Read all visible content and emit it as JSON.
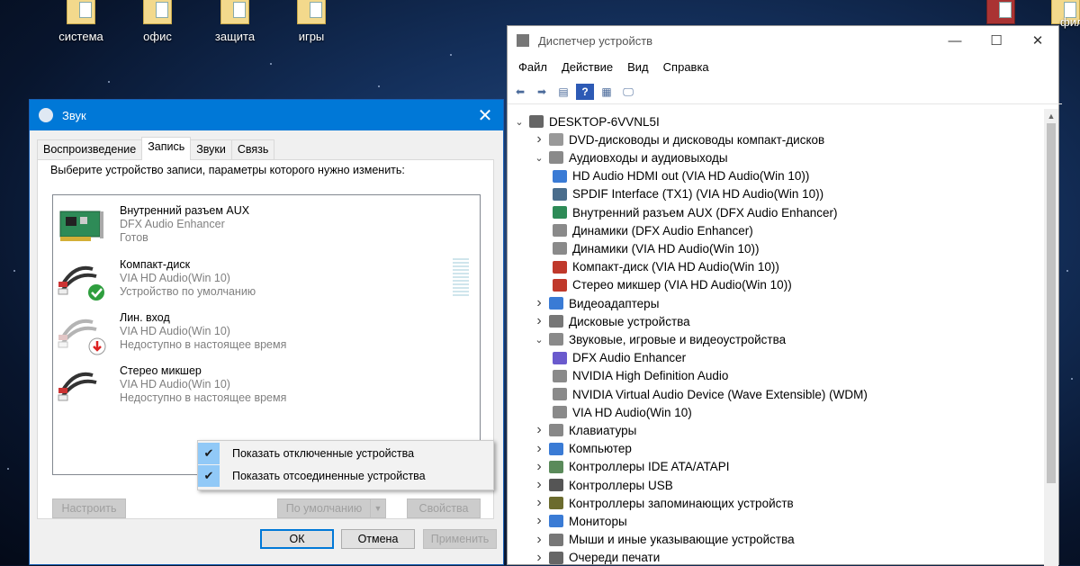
{
  "desktop": {
    "icons": [
      "система",
      "офис",
      "защита",
      "игры"
    ],
    "right_label": "фили"
  },
  "sound": {
    "title": "Звук",
    "tabs": [
      "Воспроизведение",
      "Запись",
      "Звуки",
      "Связь"
    ],
    "instruction": "Выберите устройство записи, параметры которого нужно изменить:",
    "devices": [
      {
        "name": "Внутренний разъем  AUX",
        "driver": "DFX Audio Enhancer",
        "status": "Готов"
      },
      {
        "name": "Компакт-диск",
        "driver": "VIA HD Audio(Win 10)",
        "status": "Устройство по умолчанию"
      },
      {
        "name": "Лин. вход",
        "driver": "VIA HD Audio(Win 10)",
        "status": "Недоступно в настоящее время"
      },
      {
        "name": "Стерео микшер",
        "driver": "VIA HD Audio(Win 10)",
        "status": "Недоступно в настоящее время"
      }
    ],
    "buttons": {
      "configure": "Настроить",
      "set_default": "По умолчанию",
      "properties": "Свойства",
      "ok": "ОК",
      "cancel": "Отмена",
      "apply": "Применить"
    },
    "context_menu": [
      "Показать отключенные устройства",
      "Показать отсоединенные устройства"
    ]
  },
  "devmgr": {
    "title": "Диспетчер устройств",
    "menu": [
      "Файл",
      "Действие",
      "Вид",
      "Справка"
    ],
    "tree": [
      {
        "label": "DESKTOP-6VVNL5I",
        "level": 0,
        "exp": "open",
        "icon": "computer-icon"
      },
      {
        "label": "DVD-дисководы и дисководы компакт-дисков",
        "level": 1,
        "exp": "closed",
        "icon": "dvd-drive-icon"
      },
      {
        "label": "Аудиовходы и аудиовыходы",
        "level": 1,
        "exp": "open",
        "icon": "speaker-icon"
      },
      {
        "label": "HD Audio HDMI out (VIA HD Audio(Win 10))",
        "level": 2,
        "exp": "",
        "icon": "monitor-icon"
      },
      {
        "label": "SPDIF Interface (TX1) (VIA HD Audio(Win 10))",
        "level": 2,
        "exp": "",
        "icon": "spdif-icon"
      },
      {
        "label": "Внутренний разъем  AUX (DFX Audio Enhancer)",
        "level": 2,
        "exp": "",
        "icon": "sound-card-icon"
      },
      {
        "label": "Динамики (DFX Audio Enhancer)",
        "level": 2,
        "exp": "",
        "icon": "speaker-icon"
      },
      {
        "label": "Динамики (VIA HD Audio(Win 10))",
        "level": 2,
        "exp": "",
        "icon": "speaker-icon"
      },
      {
        "label": "Компакт-диск (VIA HD Audio(Win 10))",
        "level": 2,
        "exp": "",
        "icon": "rca-cable-icon"
      },
      {
        "label": "Стерео микшер (VIA HD Audio(Win 10))",
        "level": 2,
        "exp": "",
        "icon": "rca-cable-icon"
      },
      {
        "label": "Видеоадаптеры",
        "level": 1,
        "exp": "closed",
        "icon": "display-adapter-icon"
      },
      {
        "label": "Дисковые устройства",
        "level": 1,
        "exp": "closed",
        "icon": "disk-drive-icon"
      },
      {
        "label": "Звуковые, игровые и видеоустройства",
        "level": 1,
        "exp": "open",
        "icon": "speaker-icon"
      },
      {
        "label": "DFX Audio Enhancer",
        "level": 2,
        "exp": "",
        "icon": "equalizer-icon"
      },
      {
        "label": "NVIDIA High Definition Audio",
        "level": 2,
        "exp": "",
        "icon": "speaker-icon"
      },
      {
        "label": "NVIDIA Virtual Audio Device (Wave Extensible) (WDM)",
        "level": 2,
        "exp": "",
        "icon": "speaker-icon"
      },
      {
        "label": "VIA HD Audio(Win 10)",
        "level": 2,
        "exp": "",
        "icon": "speaker-icon"
      },
      {
        "label": "Клавиатуры",
        "level": 1,
        "exp": "closed",
        "icon": "keyboard-icon"
      },
      {
        "label": "Компьютер",
        "level": 1,
        "exp": "closed",
        "icon": "monitor-icon"
      },
      {
        "label": "Контроллеры IDE ATA/ATAPI",
        "level": 1,
        "exp": "closed",
        "icon": "ide-controller-icon"
      },
      {
        "label": "Контроллеры USB",
        "level": 1,
        "exp": "closed",
        "icon": "usb-icon"
      },
      {
        "label": "Контроллеры запоминающих устройств",
        "level": 1,
        "exp": "closed",
        "icon": "storage-controller-icon"
      },
      {
        "label": "Мониторы",
        "level": 1,
        "exp": "closed",
        "icon": "monitor-icon"
      },
      {
        "label": "Мыши и иные указывающие устройства",
        "level": 1,
        "exp": "closed",
        "icon": "mouse-icon"
      },
      {
        "label": "Очереди печати",
        "level": 1,
        "exp": "closed",
        "icon": "printer-icon"
      }
    ]
  }
}
